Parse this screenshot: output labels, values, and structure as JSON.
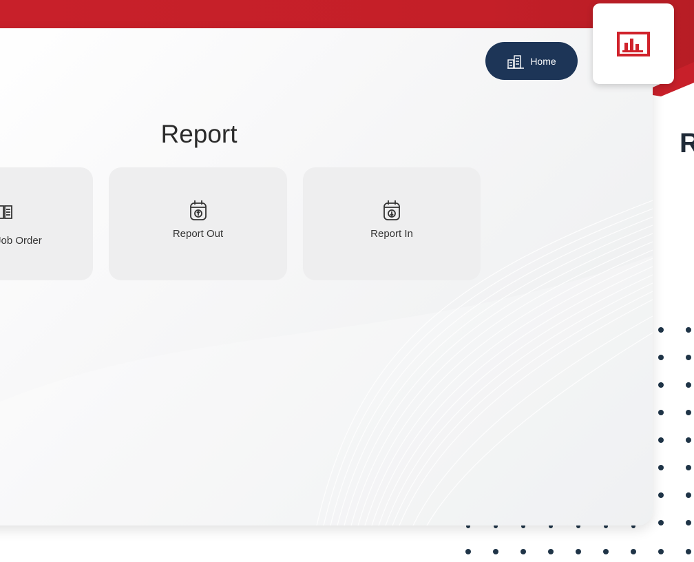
{
  "header": {
    "home_label": "Home",
    "side_heading_fragment": "R"
  },
  "main": {
    "title": "Report",
    "tiles": [
      {
        "label": "Job Order",
        "icon": "book-icon"
      },
      {
        "label": "Report Out",
        "icon": "calendar-upload-icon"
      },
      {
        "label": "Report In",
        "icon": "calendar-download-icon"
      }
    ]
  },
  "badge": {
    "icon": "bar-chart-icon"
  },
  "colors": {
    "brand_red": "#c8202a",
    "navy": "#1d3557",
    "tile_bg": "#eeeeef"
  }
}
